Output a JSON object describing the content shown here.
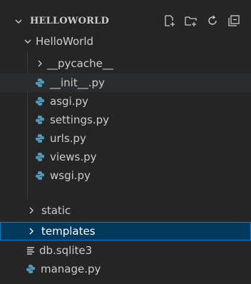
{
  "explorer": {
    "section_title": "HELLOWORLD",
    "actions": [
      {
        "name": "new-file-icon"
      },
      {
        "name": "new-folder-icon"
      },
      {
        "name": "refresh-icon"
      },
      {
        "name": "collapse-all-icon"
      }
    ]
  },
  "tree": {
    "project_folder": "HelloWorld",
    "pycache": "__pycache__",
    "init": "__init__.py",
    "asgi": "asgi.py",
    "settings": "settings.py",
    "urls": "urls.py",
    "views": "views.py",
    "wsgi": "wsgi.py",
    "static": "static",
    "templates": "templates",
    "db": "db.sqlite3",
    "manage": "manage.py"
  },
  "colors": {
    "python_icon": "#519aba",
    "selected_bg": "#04395e",
    "selected_border": "#007fd4"
  }
}
